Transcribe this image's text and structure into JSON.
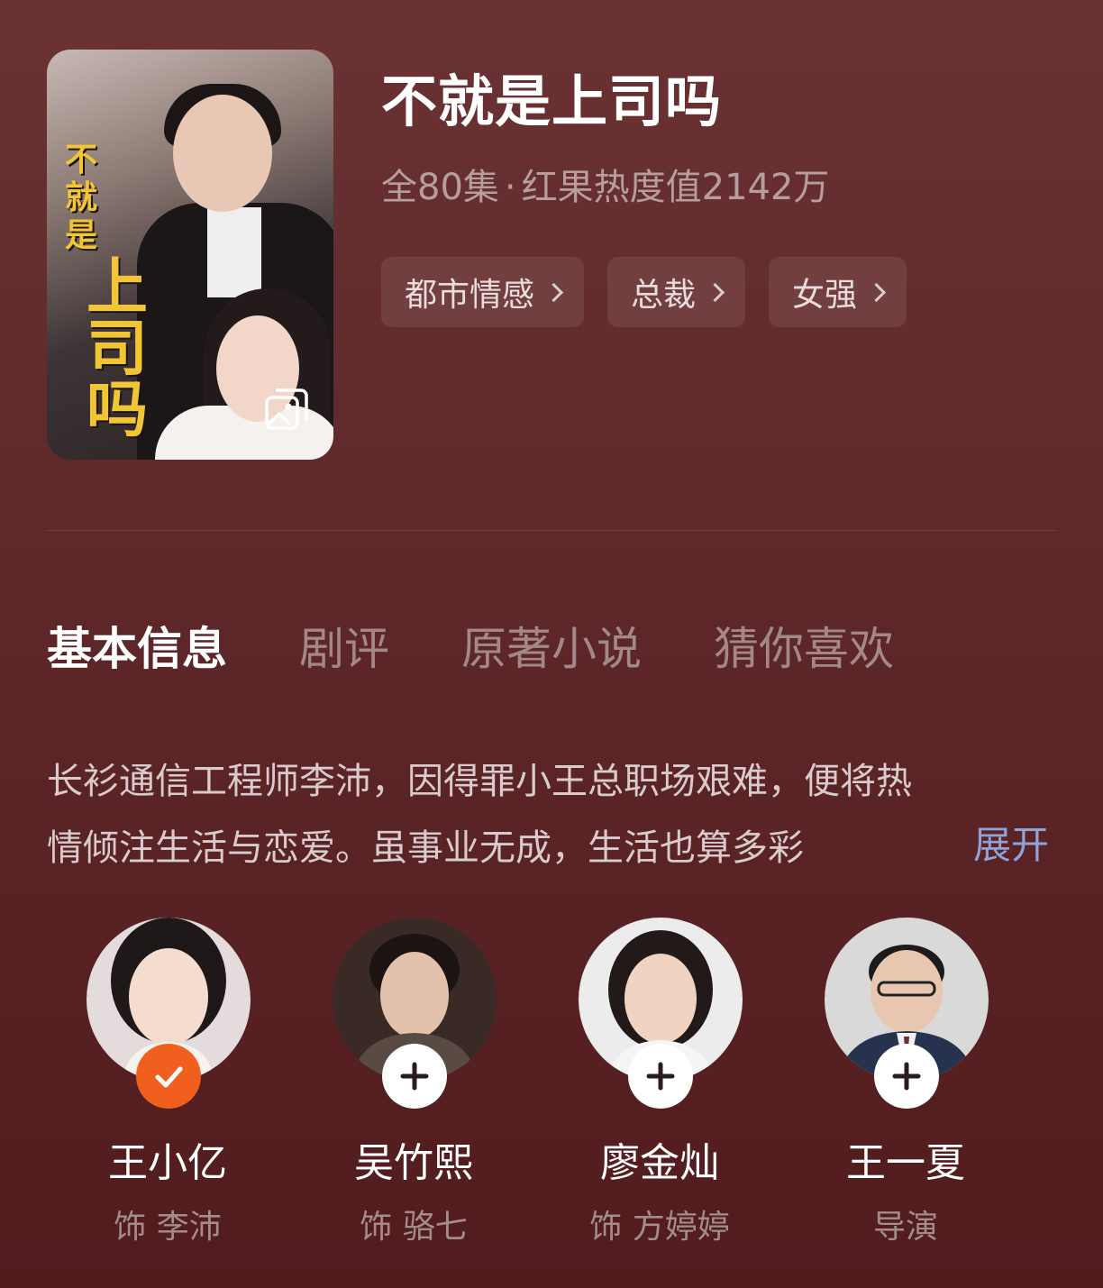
{
  "drama": {
    "title": "不就是上司吗",
    "episodes": "全80集",
    "separator": "·",
    "popularity": "红果热度值2142万",
    "poster": {
      "title_line1": "不",
      "title_line2": "就",
      "title_line3": "是",
      "title_line4": "上",
      "title_line5": "司",
      "title_line6": "吗",
      "gallery_icon": "image-gallery-icon"
    },
    "tags": [
      {
        "label": "都市情感",
        "icon": "chevron-right-icon"
      },
      {
        "label": "总裁",
        "icon": "chevron-right-icon"
      },
      {
        "label": "女强",
        "icon": "chevron-right-icon"
      }
    ]
  },
  "tabs": [
    {
      "label": "基本信息",
      "active": true
    },
    {
      "label": "剧评",
      "active": false
    },
    {
      "label": "原著小说",
      "active": false
    },
    {
      "label": "猜你喜欢",
      "active": false
    }
  ],
  "synopsis": {
    "line1": "长衫通信工程师李沛，因得罪小王总职场艰难，便将热",
    "line2": "情倾注生活与恋爱。虽事业无成，生活也算多彩",
    "expand_label": "展开"
  },
  "cast": [
    {
      "name": "王小亿",
      "role": "饰 李沛",
      "status": "followed",
      "badge_icon": "checkmark-icon"
    },
    {
      "name": "吴竹熙",
      "role": "饰 骆七",
      "status": "follow",
      "badge_icon": "plus-icon"
    },
    {
      "name": "廖金灿",
      "role": "饰 方婷婷",
      "status": "follow",
      "badge_icon": "plus-icon"
    },
    {
      "name": "王一夏",
      "role": "导演",
      "status": "follow",
      "badge_icon": "plus-icon"
    }
  ],
  "colors": {
    "background": "#5e2729",
    "accent_followed": "#f15f1e",
    "expand_link": "#8fa3d8",
    "poster_title": "#f2c535"
  }
}
